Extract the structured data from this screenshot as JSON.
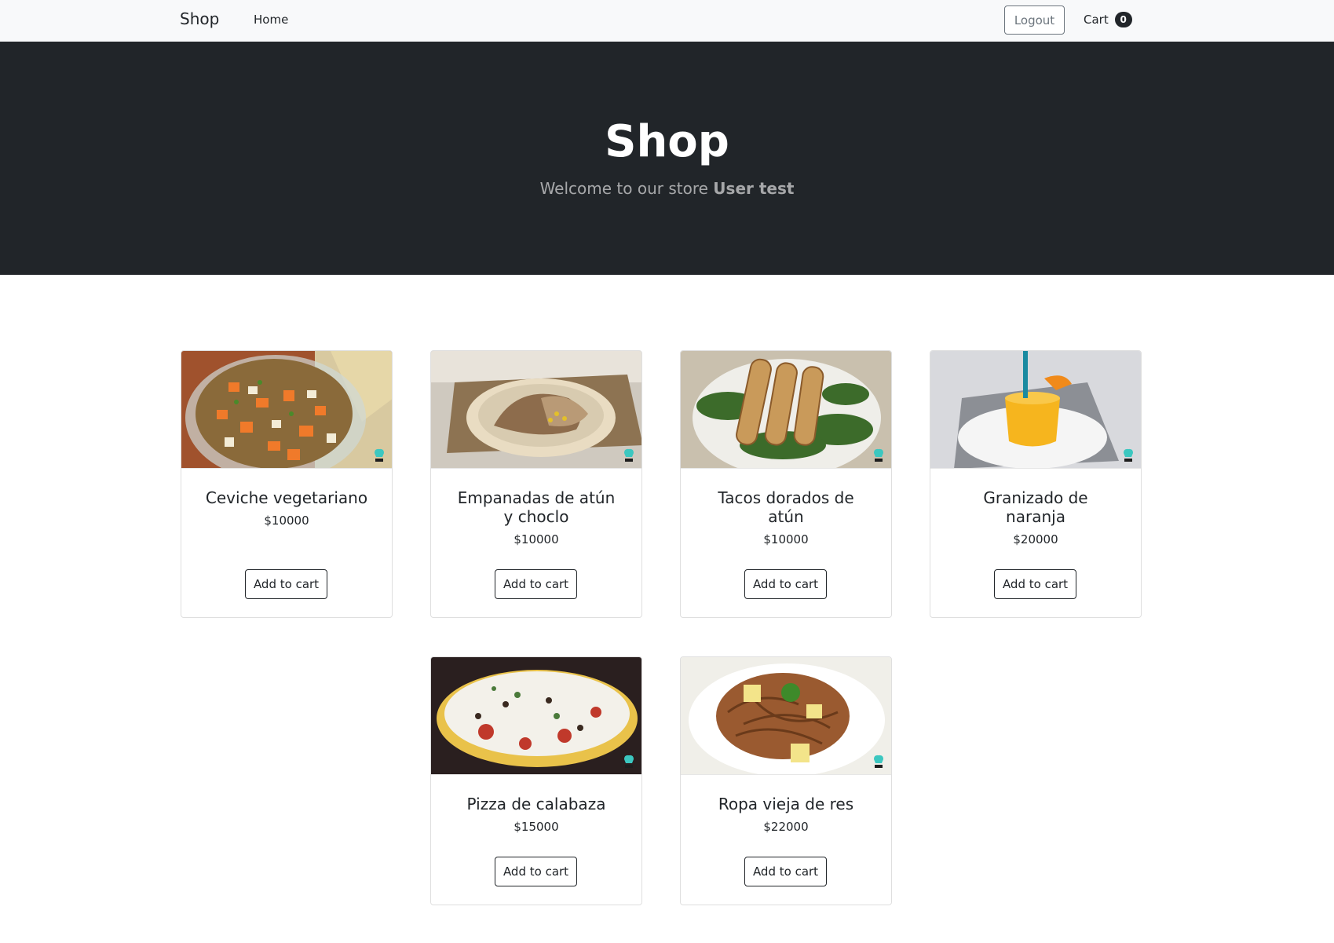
{
  "navbar": {
    "brand": "Shop",
    "home_label": "Home",
    "logout_label": "Logout",
    "cart_label": "Cart",
    "cart_count": "0"
  },
  "hero": {
    "title": "Shop",
    "subtitle_prefix": "Welcome to our store",
    "user_name": "User test"
  },
  "products": [
    {
      "name": "Ceviche vegetariano",
      "price": "$10000",
      "button": "Add to cart",
      "image_icon": "ceviche-image"
    },
    {
      "name": "Empanadas de atún y choclo",
      "price": "$10000",
      "button": "Add to cart",
      "image_icon": "empanadas-image"
    },
    {
      "name": "Tacos dorados de atún",
      "price": "$10000",
      "button": "Add to cart",
      "image_icon": "tacos-image"
    },
    {
      "name": "Granizado de naranja",
      "price": "$20000",
      "button": "Add to cart",
      "image_icon": "granizado-image"
    },
    {
      "name": "Pizza de calabaza",
      "price": "$15000",
      "button": "Add to cart",
      "image_icon": "pizza-image"
    },
    {
      "name": "Ropa vieja de res",
      "price": "$22000",
      "button": "Add to cart",
      "image_icon": "ropa-vieja-image"
    }
  ],
  "colors": {
    "navbar_bg": "#f8f9fa",
    "hero_bg": "#212529",
    "text": "#212529",
    "chef_icon": "#3cc7c0"
  }
}
